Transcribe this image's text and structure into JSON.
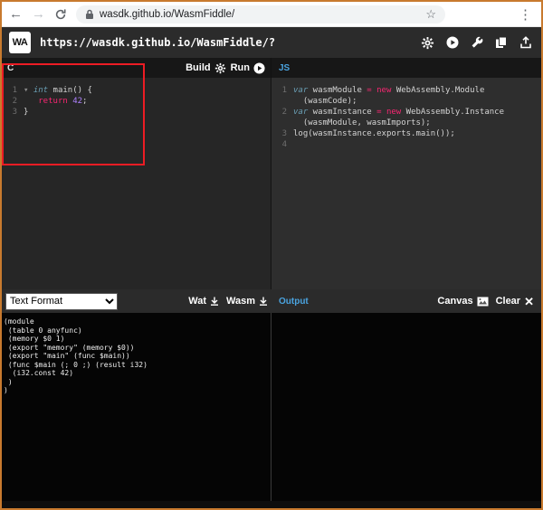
{
  "browser": {
    "url": "wasdk.github.io/WasmFiddle/",
    "icons": {
      "back": "←",
      "forward": "→",
      "star": "☆",
      "menu": "⋮"
    }
  },
  "header": {
    "logo": "WA",
    "title": "https://wasdk.github.io/WasmFiddle/?"
  },
  "editor_toolbar": {
    "c_tab": "C",
    "build": "Build",
    "run": "Run",
    "js_tab": "JS"
  },
  "c_editor": {
    "lines": [
      {
        "num": "1",
        "tokens": [
          {
            "c": "fold",
            "t": "▾ "
          },
          {
            "c": "kw",
            "t": "int"
          },
          {
            "c": "p",
            "t": " main() {"
          }
        ]
      },
      {
        "num": "2",
        "tokens": [
          {
            "c": "p",
            "t": "   "
          },
          {
            "c": "op",
            "t": "return"
          },
          {
            "c": "p",
            "t": " "
          },
          {
            "c": "num",
            "t": "42"
          },
          {
            "c": "p",
            "t": ";"
          }
        ]
      },
      {
        "num": "3",
        "tokens": [
          {
            "c": "p",
            "t": "}"
          }
        ]
      }
    ]
  },
  "js_editor": {
    "lines": [
      {
        "num": "1",
        "tokens": [
          {
            "c": "kw",
            "t": "var"
          },
          {
            "c": "p",
            "t": " wasmModule "
          },
          {
            "c": "op",
            "t": "="
          },
          {
            "c": "p",
            "t": " "
          },
          {
            "c": "op",
            "t": "new"
          },
          {
            "c": "p",
            "t": " WebAssembly.Module"
          }
        ]
      },
      {
        "num": "",
        "tokens": [
          {
            "c": "p",
            "t": "  (wasmCode);"
          }
        ]
      },
      {
        "num": "2",
        "tokens": [
          {
            "c": "kw",
            "t": "var"
          },
          {
            "c": "p",
            "t": " wasmInstance "
          },
          {
            "c": "op",
            "t": "="
          },
          {
            "c": "p",
            "t": " "
          },
          {
            "c": "op",
            "t": "new"
          },
          {
            "c": "p",
            "t": " WebAssembly.Instance"
          }
        ]
      },
      {
        "num": "",
        "tokens": [
          {
            "c": "p",
            "t": "  (wasmModule, wasmImports);"
          }
        ]
      },
      {
        "num": "3",
        "tokens": [
          {
            "c": "p",
            "t": "log(wasmInstance.exports.main());"
          }
        ]
      },
      {
        "num": "4",
        "tokens": []
      }
    ]
  },
  "bottom_toolbar": {
    "format_select": "Text Format",
    "wat": "Wat",
    "wasm": "Wasm",
    "output_tab": "Output",
    "canvas": "Canvas",
    "clear": "Clear"
  },
  "output": {
    "lines": [
      "(module",
      " (table 0 anyfunc)",
      " (memory $0 1)",
      " (export \"memory\" (memory $0))",
      " (export \"main\" (func $main))",
      " (func $main (; 0 ;) (result i32)",
      "  (i32.const 42)",
      " )",
      ")"
    ]
  },
  "colors": {
    "accent_blue": "#4aa3df",
    "annotation_red": "#ec1c24",
    "keyword": "#6a9fb5",
    "operator": "#f92672",
    "number": "#ae81ff"
  }
}
